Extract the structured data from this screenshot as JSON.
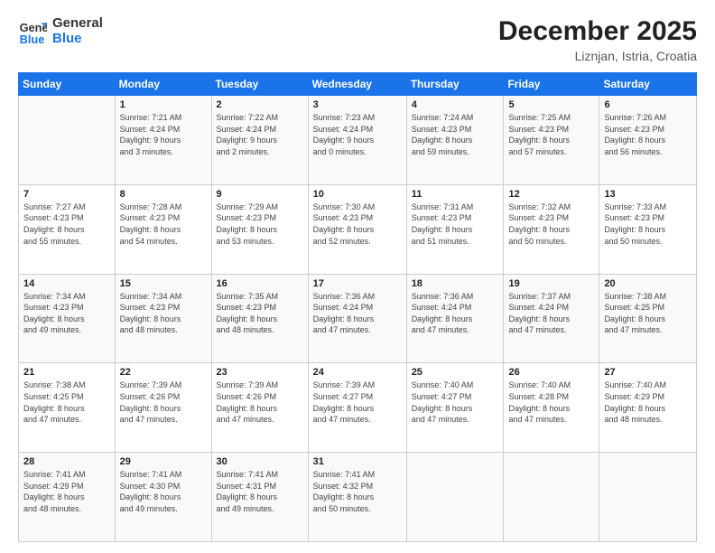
{
  "logo": {
    "line1": "General",
    "line2": "Blue"
  },
  "header": {
    "month": "December 2025",
    "location": "Liznjan, Istria, Croatia"
  },
  "weekdays": [
    "Sunday",
    "Monday",
    "Tuesday",
    "Wednesday",
    "Thursday",
    "Friday",
    "Saturday"
  ],
  "weeks": [
    [
      {
        "day": "",
        "sunrise": "",
        "sunset": "",
        "daylight": ""
      },
      {
        "day": "1",
        "sunrise": "Sunrise: 7:21 AM",
        "sunset": "Sunset: 4:24 PM",
        "daylight": "Daylight: 9 hours and 3 minutes."
      },
      {
        "day": "2",
        "sunrise": "Sunrise: 7:22 AM",
        "sunset": "Sunset: 4:24 PM",
        "daylight": "Daylight: 9 hours and 2 minutes."
      },
      {
        "day": "3",
        "sunrise": "Sunrise: 7:23 AM",
        "sunset": "Sunset: 4:24 PM",
        "daylight": "Daylight: 9 hours and 0 minutes."
      },
      {
        "day": "4",
        "sunrise": "Sunrise: 7:24 AM",
        "sunset": "Sunset: 4:23 PM",
        "daylight": "Daylight: 8 hours and 59 minutes."
      },
      {
        "day": "5",
        "sunrise": "Sunrise: 7:25 AM",
        "sunset": "Sunset: 4:23 PM",
        "daylight": "Daylight: 8 hours and 57 minutes."
      },
      {
        "day": "6",
        "sunrise": "Sunrise: 7:26 AM",
        "sunset": "Sunset: 4:23 PM",
        "daylight": "Daylight: 8 hours and 56 minutes."
      }
    ],
    [
      {
        "day": "7",
        "sunrise": "Sunrise: 7:27 AM",
        "sunset": "Sunset: 4:23 PM",
        "daylight": "Daylight: 8 hours and 55 minutes."
      },
      {
        "day": "8",
        "sunrise": "Sunrise: 7:28 AM",
        "sunset": "Sunset: 4:23 PM",
        "daylight": "Daylight: 8 hours and 54 minutes."
      },
      {
        "day": "9",
        "sunrise": "Sunrise: 7:29 AM",
        "sunset": "Sunset: 4:23 PM",
        "daylight": "Daylight: 8 hours and 53 minutes."
      },
      {
        "day": "10",
        "sunrise": "Sunrise: 7:30 AM",
        "sunset": "Sunset: 4:23 PM",
        "daylight": "Daylight: 8 hours and 52 minutes."
      },
      {
        "day": "11",
        "sunrise": "Sunrise: 7:31 AM",
        "sunset": "Sunset: 4:23 PM",
        "daylight": "Daylight: 8 hours and 51 minutes."
      },
      {
        "day": "12",
        "sunrise": "Sunrise: 7:32 AM",
        "sunset": "Sunset: 4:23 PM",
        "daylight": "Daylight: 8 hours and 50 minutes."
      },
      {
        "day": "13",
        "sunrise": "Sunrise: 7:33 AM",
        "sunset": "Sunset: 4:23 PM",
        "daylight": "Daylight: 8 hours and 50 minutes."
      }
    ],
    [
      {
        "day": "14",
        "sunrise": "Sunrise: 7:34 AM",
        "sunset": "Sunset: 4:23 PM",
        "daylight": "Daylight: 8 hours and 49 minutes."
      },
      {
        "day": "15",
        "sunrise": "Sunrise: 7:34 AM",
        "sunset": "Sunset: 4:23 PM",
        "daylight": "Daylight: 8 hours and 48 minutes."
      },
      {
        "day": "16",
        "sunrise": "Sunrise: 7:35 AM",
        "sunset": "Sunset: 4:23 PM",
        "daylight": "Daylight: 8 hours and 48 minutes."
      },
      {
        "day": "17",
        "sunrise": "Sunrise: 7:36 AM",
        "sunset": "Sunset: 4:24 PM",
        "daylight": "Daylight: 8 hours and 47 minutes."
      },
      {
        "day": "18",
        "sunrise": "Sunrise: 7:36 AM",
        "sunset": "Sunset: 4:24 PM",
        "daylight": "Daylight: 8 hours and 47 minutes."
      },
      {
        "day": "19",
        "sunrise": "Sunrise: 7:37 AM",
        "sunset": "Sunset: 4:24 PM",
        "daylight": "Daylight: 8 hours and 47 minutes."
      },
      {
        "day": "20",
        "sunrise": "Sunrise: 7:38 AM",
        "sunset": "Sunset: 4:25 PM",
        "daylight": "Daylight: 8 hours and 47 minutes."
      }
    ],
    [
      {
        "day": "21",
        "sunrise": "Sunrise: 7:38 AM",
        "sunset": "Sunset: 4:25 PM",
        "daylight": "Daylight: 8 hours and 47 minutes."
      },
      {
        "day": "22",
        "sunrise": "Sunrise: 7:39 AM",
        "sunset": "Sunset: 4:26 PM",
        "daylight": "Daylight: 8 hours and 47 minutes."
      },
      {
        "day": "23",
        "sunrise": "Sunrise: 7:39 AM",
        "sunset": "Sunset: 4:26 PM",
        "daylight": "Daylight: 8 hours and 47 minutes."
      },
      {
        "day": "24",
        "sunrise": "Sunrise: 7:39 AM",
        "sunset": "Sunset: 4:27 PM",
        "daylight": "Daylight: 8 hours and 47 minutes."
      },
      {
        "day": "25",
        "sunrise": "Sunrise: 7:40 AM",
        "sunset": "Sunset: 4:27 PM",
        "daylight": "Daylight: 8 hours and 47 minutes."
      },
      {
        "day": "26",
        "sunrise": "Sunrise: 7:40 AM",
        "sunset": "Sunset: 4:28 PM",
        "daylight": "Daylight: 8 hours and 47 minutes."
      },
      {
        "day": "27",
        "sunrise": "Sunrise: 7:40 AM",
        "sunset": "Sunset: 4:29 PM",
        "daylight": "Daylight: 8 hours and 48 minutes."
      }
    ],
    [
      {
        "day": "28",
        "sunrise": "Sunrise: 7:41 AM",
        "sunset": "Sunset: 4:29 PM",
        "daylight": "Daylight: 8 hours and 48 minutes."
      },
      {
        "day": "29",
        "sunrise": "Sunrise: 7:41 AM",
        "sunset": "Sunset: 4:30 PM",
        "daylight": "Daylight: 8 hours and 49 minutes."
      },
      {
        "day": "30",
        "sunrise": "Sunrise: 7:41 AM",
        "sunset": "Sunset: 4:31 PM",
        "daylight": "Daylight: 8 hours and 49 minutes."
      },
      {
        "day": "31",
        "sunrise": "Sunrise: 7:41 AM",
        "sunset": "Sunset: 4:32 PM",
        "daylight": "Daylight: 8 hours and 50 minutes."
      },
      {
        "day": "",
        "sunrise": "",
        "sunset": "",
        "daylight": ""
      },
      {
        "day": "",
        "sunrise": "",
        "sunset": "",
        "daylight": ""
      },
      {
        "day": "",
        "sunrise": "",
        "sunset": "",
        "daylight": ""
      }
    ]
  ]
}
